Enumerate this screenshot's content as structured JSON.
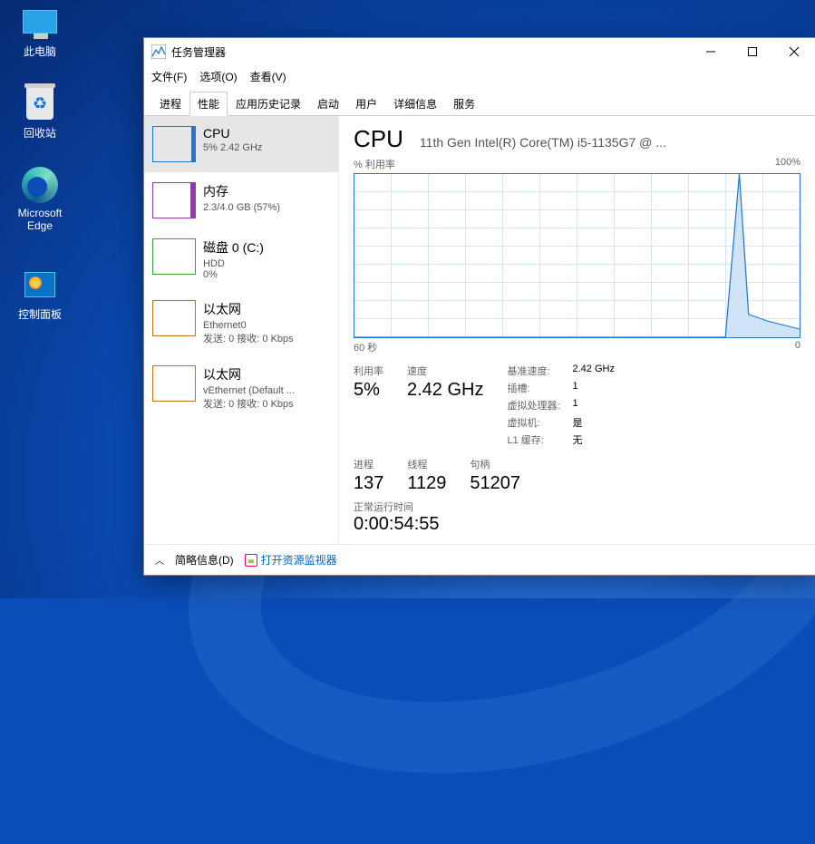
{
  "desktop": {
    "pc": "此电脑",
    "bin": "回收站",
    "edge_l1": "Microsoft",
    "edge_l2": "Edge",
    "cp": "控制面板"
  },
  "window": {
    "title": "任务管理器",
    "menu": {
      "file": "文件(F)",
      "options": "选项(O)",
      "view": "查看(V)"
    },
    "tabs": {
      "processes": "进程",
      "performance": "性能",
      "history": "应用历史记录",
      "startup": "启动",
      "users": "用户",
      "details": "详细信息",
      "services": "服务"
    }
  },
  "sidebar": [
    {
      "title": "CPU",
      "sub": "5% 2.42 GHz"
    },
    {
      "title": "内存",
      "sub": "2.3/4.0 GB (57%)"
    },
    {
      "title": "磁盘 0 (C:)",
      "sub1": "HDD",
      "sub2": "0%"
    },
    {
      "title": "以太网",
      "sub1": "Ethernet0",
      "sub2": "发送: 0 接收: 0 Kbps"
    },
    {
      "title": "以太网",
      "sub1": "vEthernet (Default ...",
      "sub2": "发送: 0 接收: 0 Kbps"
    }
  ],
  "main": {
    "title": "CPU",
    "subtitle": "11th Gen Intel(R) Core(TM) i5-1135G7 @ ...",
    "graph": {
      "top_left": "% 利用率",
      "top_right": "100%",
      "bot_left": "60 秒",
      "bot_right": "0"
    },
    "stats": {
      "util_label": "利用率",
      "util_val": "5%",
      "speed_label": "速度",
      "speed_val": "2.42 GHz",
      "proc_label": "进程",
      "proc_val": "137",
      "thr_label": "线程",
      "thr_val": "1129",
      "hnd_label": "句柄",
      "hnd_val": "51207"
    },
    "kv": {
      "base_k": "基准速度:",
      "base_v": "2.42 GHz",
      "sock_k": "插槽:",
      "sock_v": "1",
      "vproc_k": "虚拟处理器:",
      "vproc_v": "1",
      "vm_k": "虚拟机:",
      "vm_v": "是",
      "l1_k": "L1 缓存:",
      "l1_v": "无"
    },
    "uptime_label": "正常运行时间",
    "uptime_val": "0:00:54:55"
  },
  "footer": {
    "fewer": "简略信息(D)",
    "resmon": "打开资源监视器"
  },
  "chart_data": {
    "type": "line",
    "title": "% 利用率",
    "xlabel": "60 秒",
    "ylabel": "% 利用率",
    "ylim": [
      0,
      100
    ],
    "x": [
      60,
      57,
      54,
      51,
      48,
      45,
      42,
      39,
      36,
      33,
      30,
      27,
      24,
      21,
      18,
      15,
      12,
      9,
      6,
      3,
      0
    ],
    "series": [
      {
        "name": "CPU",
        "values": [
          0,
          0,
          0,
          0,
          0,
          0,
          0,
          0,
          0,
          0,
          0,
          0,
          0,
          0,
          0,
          0,
          0,
          100,
          14,
          10,
          5
        ]
      }
    ]
  }
}
